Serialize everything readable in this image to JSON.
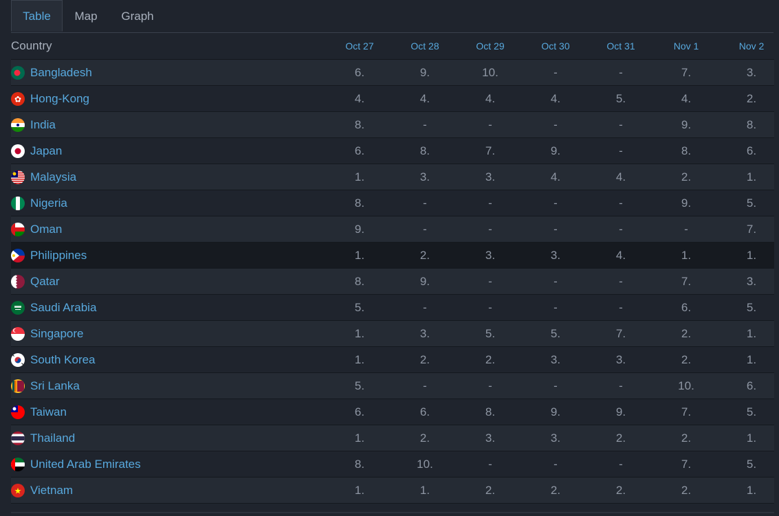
{
  "tabs": [
    "Table",
    "Map",
    "Graph"
  ],
  "active_tab": "Table",
  "table": {
    "country_header": "Country",
    "dates": [
      "Oct 27",
      "Oct 28",
      "Oct 29",
      "Oct 30",
      "Oct 31",
      "Nov 1",
      "Nov 2"
    ],
    "rows": [
      {
        "country": "Bangladesh",
        "flag": "bangladesh-flag-icon",
        "values": [
          "6.",
          "9.",
          "10.",
          "-",
          "-",
          "7.",
          "3."
        ]
      },
      {
        "country": "Hong-Kong",
        "flag": "hong-kong-flag-icon",
        "values": [
          "4.",
          "4.",
          "4.",
          "4.",
          "5.",
          "4.",
          "2."
        ]
      },
      {
        "country": "India",
        "flag": "india-flag-icon",
        "values": [
          "8.",
          "-",
          "-",
          "-",
          "-",
          "9.",
          "8."
        ]
      },
      {
        "country": "Japan",
        "flag": "japan-flag-icon",
        "values": [
          "6.",
          "8.",
          "7.",
          "9.",
          "-",
          "8.",
          "6."
        ]
      },
      {
        "country": "Malaysia",
        "flag": "malaysia-flag-icon",
        "values": [
          "1.",
          "3.",
          "3.",
          "4.",
          "4.",
          "2.",
          "1."
        ]
      },
      {
        "country": "Nigeria",
        "flag": "nigeria-flag-icon",
        "values": [
          "8.",
          "-",
          "-",
          "-",
          "-",
          "9.",
          "5."
        ]
      },
      {
        "country": "Oman",
        "flag": "oman-flag-icon",
        "values": [
          "9.",
          "-",
          "-",
          "-",
          "-",
          "-",
          "7."
        ]
      },
      {
        "country": "Philippines",
        "flag": "philippines-flag-icon",
        "values": [
          "1.",
          "2.",
          "3.",
          "3.",
          "4.",
          "1.",
          "1."
        ]
      },
      {
        "country": "Qatar",
        "flag": "qatar-flag-icon",
        "values": [
          "8.",
          "9.",
          "-",
          "-",
          "-",
          "7.",
          "3."
        ]
      },
      {
        "country": "Saudi Arabia",
        "flag": "saudi-arabia-flag-icon",
        "values": [
          "5.",
          "-",
          "-",
          "-",
          "-",
          "6.",
          "5."
        ]
      },
      {
        "country": "Singapore",
        "flag": "singapore-flag-icon",
        "values": [
          "1.",
          "3.",
          "5.",
          "5.",
          "7.",
          "2.",
          "1."
        ]
      },
      {
        "country": "South Korea",
        "flag": "south-korea-flag-icon",
        "values": [
          "1.",
          "2.",
          "2.",
          "3.",
          "3.",
          "2.",
          "1."
        ]
      },
      {
        "country": "Sri Lanka",
        "flag": "sri-lanka-flag-icon",
        "values": [
          "5.",
          "-",
          "-",
          "-",
          "-",
          "10.",
          "6."
        ]
      },
      {
        "country": "Taiwan",
        "flag": "taiwan-flag-icon",
        "values": [
          "6.",
          "6.",
          "8.",
          "9.",
          "9.",
          "7.",
          "5."
        ]
      },
      {
        "country": "Thailand",
        "flag": "thailand-flag-icon",
        "values": [
          "1.",
          "2.",
          "3.",
          "3.",
          "2.",
          "2.",
          "1."
        ]
      },
      {
        "country": "United Arab Emirates",
        "flag": "uae-flag-icon",
        "values": [
          "8.",
          "10.",
          "-",
          "-",
          "-",
          "7.",
          "5."
        ]
      },
      {
        "country": "Vietnam",
        "flag": "vietnam-flag-icon",
        "values": [
          "1.",
          "1.",
          "2.",
          "2.",
          "2.",
          "2.",
          "1."
        ]
      }
    ],
    "highlighted_row": "Philippines"
  },
  "colors": {
    "background": "#1f242d",
    "accent": "#58a9de",
    "value_text": "#8e96a3"
  }
}
